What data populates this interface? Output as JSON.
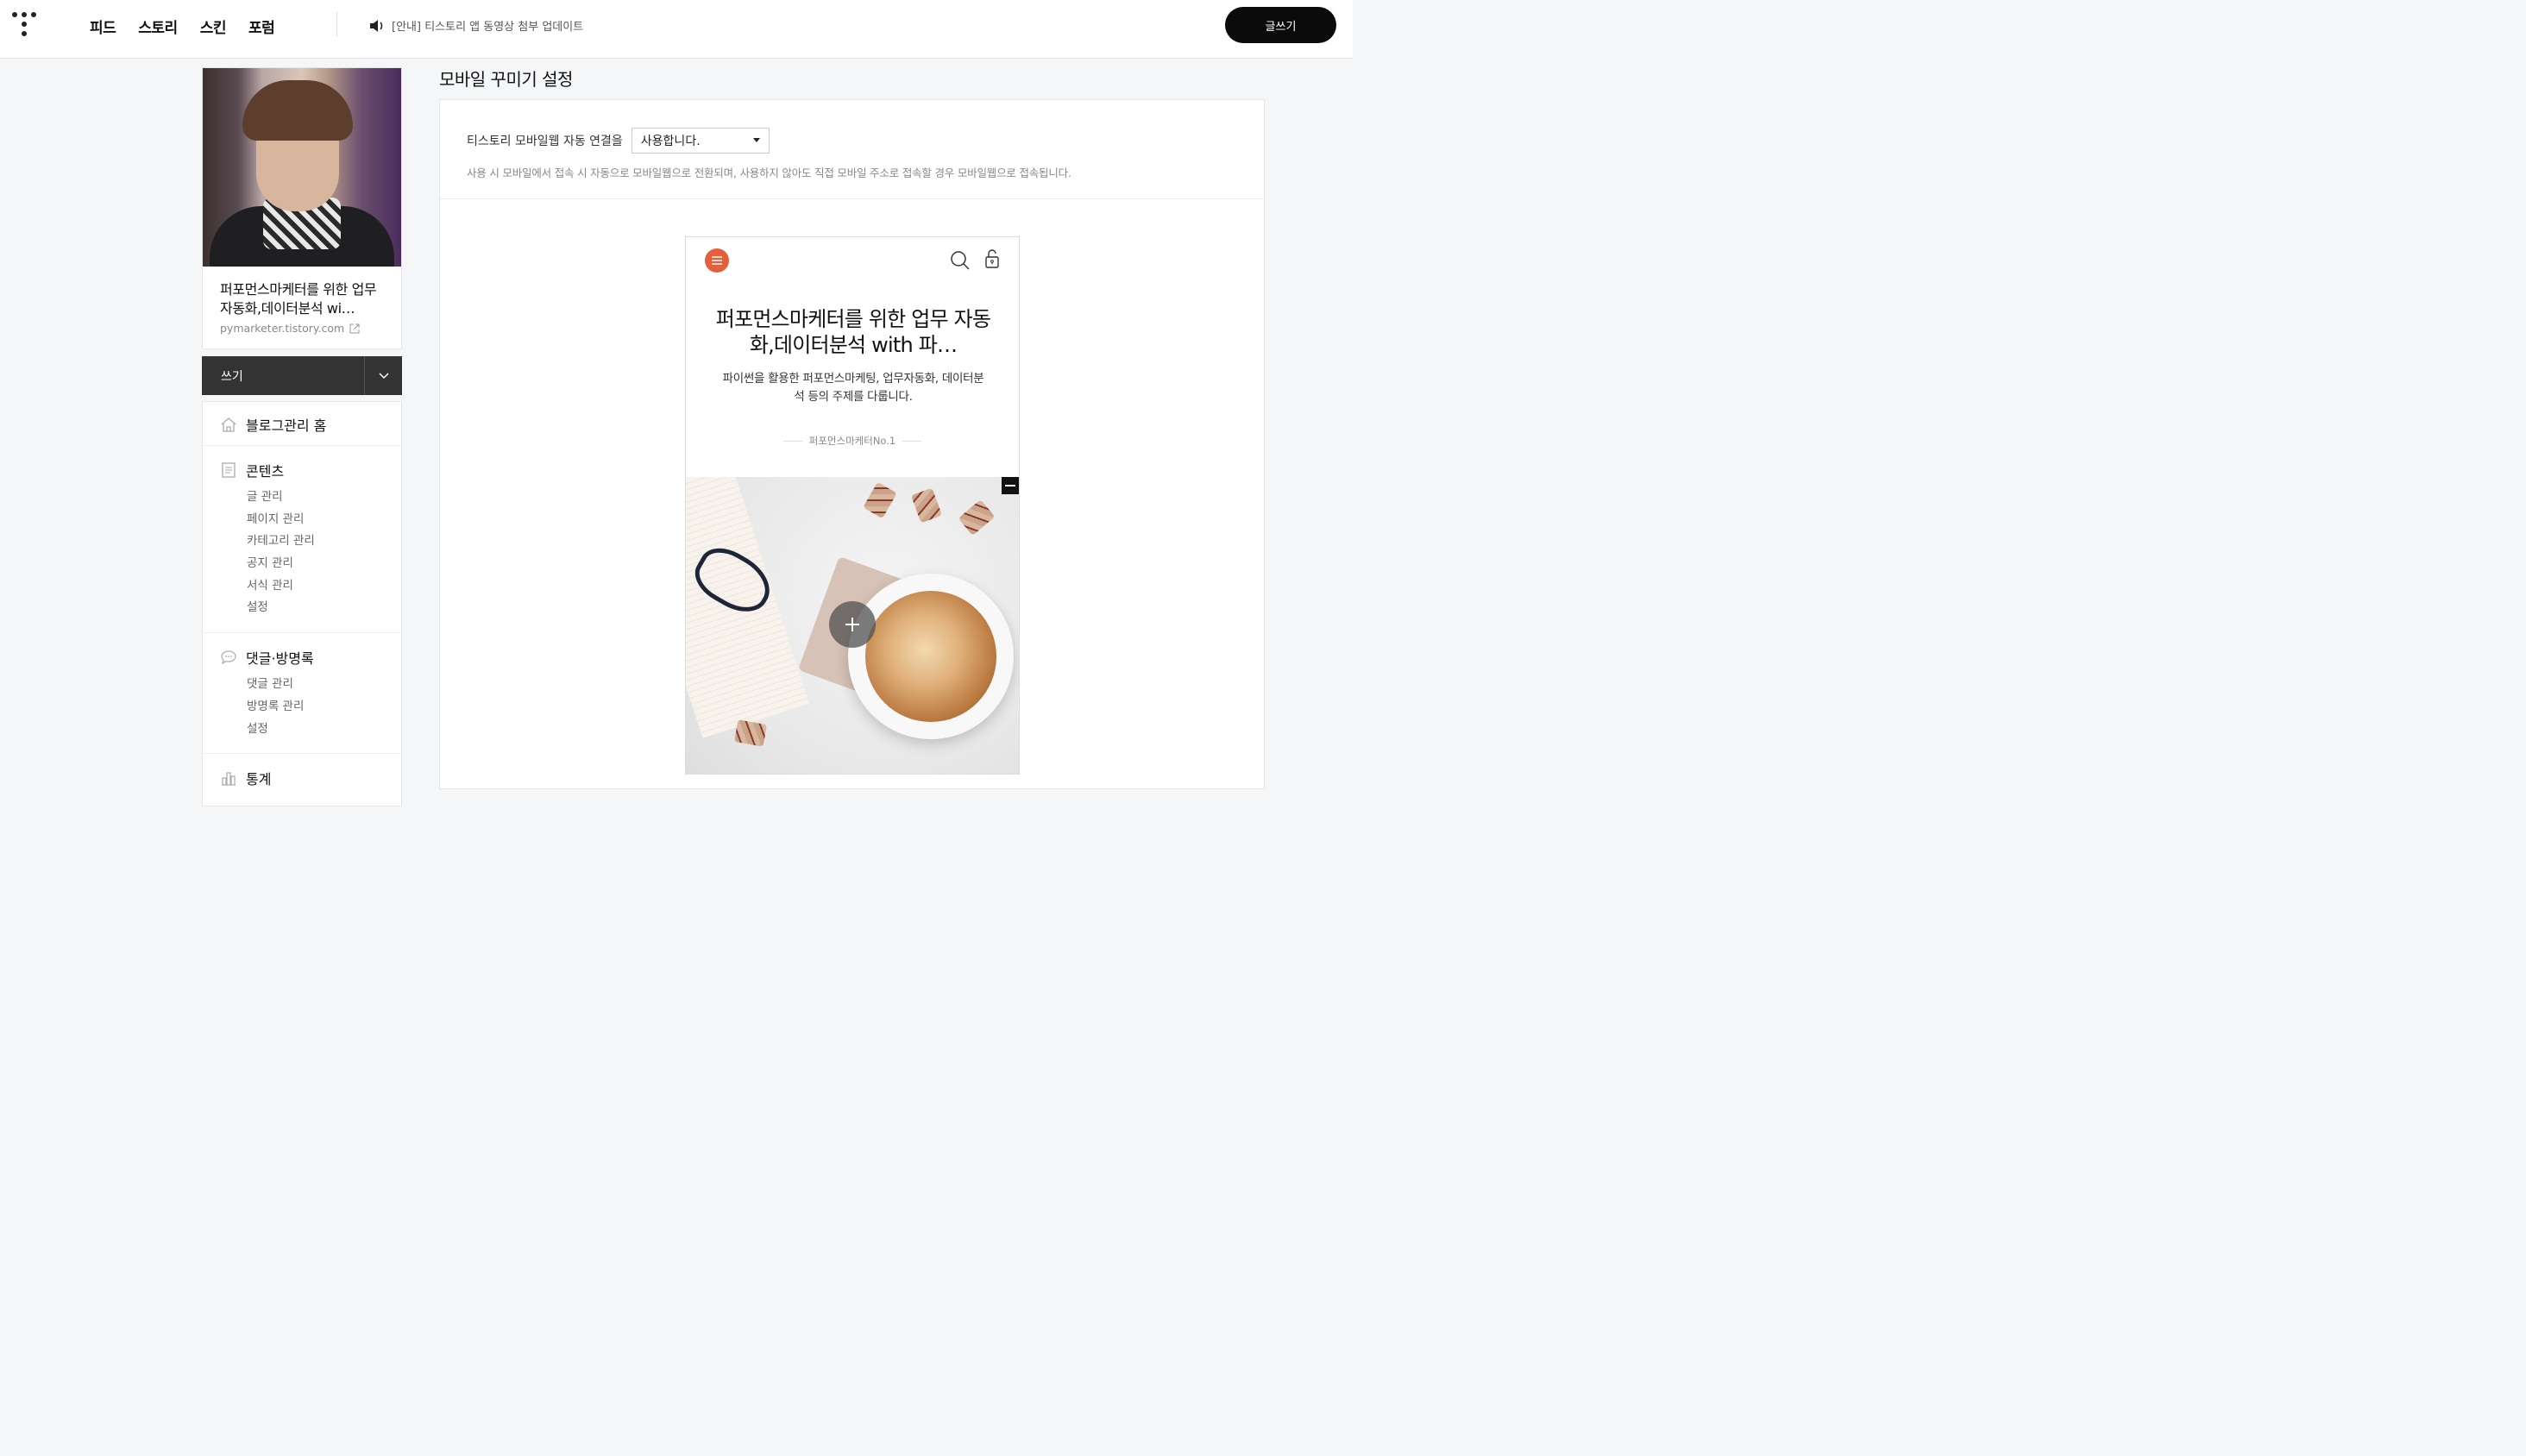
{
  "header": {
    "nav": [
      "피드",
      "스토리",
      "스킨",
      "포럼"
    ],
    "notice": "[안내] 티스토리 앱 동영상 첨부 업데이트",
    "write_button": "글쓰기"
  },
  "sidebar": {
    "blog_name": "퍼포먼스마케터를 위한 업무자동화,데이터분석 wi…",
    "blog_url": "pymarketer.tistory.com",
    "write_label": "쓰기",
    "menu": {
      "home": "블로그관리 홈",
      "contents": {
        "title": "콘텐츠",
        "items": [
          "글 관리",
          "페이지 관리",
          "카테고리 관리",
          "공지 관리",
          "서식 관리",
          "설정"
        ]
      },
      "comments": {
        "title": "댓글·방명록",
        "items": [
          "댓글 관리",
          "방명록 관리",
          "설정"
        ]
      },
      "stats": "통계"
    }
  },
  "main": {
    "title": "모바일 꾸미기 설정",
    "setting_label": "티스토리 모바일웹 자동 연결을",
    "select_value": "사용합니다.",
    "hint": "사용 시 모바일에서 접속 시 자동으로 모바일웹으로 전환되며, 사용하지 않아도 직접 모바일 주소로 접속할 경우 모바일웹으로 접속됩니다."
  },
  "preview": {
    "title": "퍼포먼스마케터를 위한 업무 자동화,데이터분석 with 파…",
    "description": "파이썬을 활용한 퍼포먼스마케팅, 업무자동화, 데이터분석 등의 주제를 다룹니다.",
    "author": "퍼포먼스마케터No.1"
  },
  "colors": {
    "accent": "#e5603a",
    "dark": "#0b0b0b",
    "write_bar": "#333333"
  }
}
